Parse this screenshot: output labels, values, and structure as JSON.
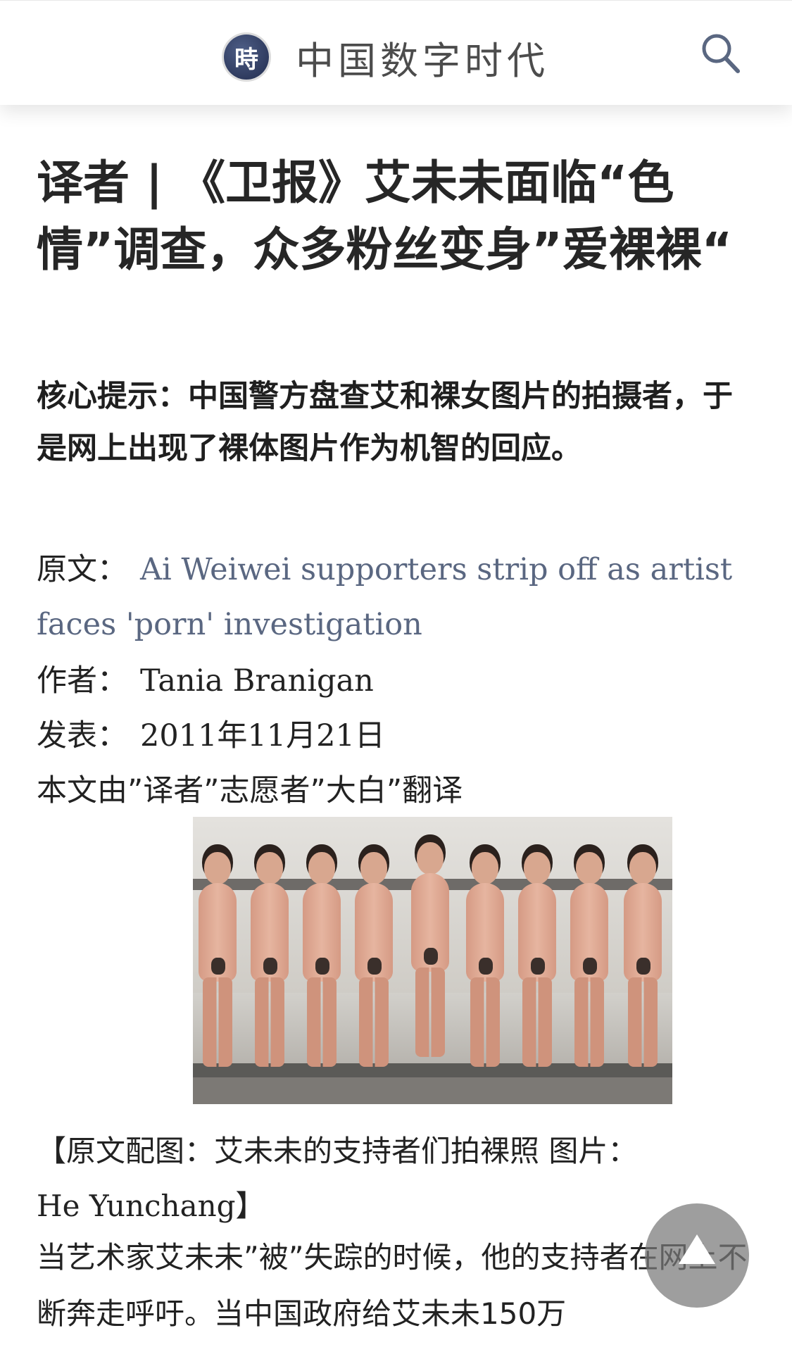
{
  "header": {
    "logo_glyph": "時",
    "site_name": "中国数字时代",
    "search_icon": "search-icon"
  },
  "article": {
    "title": "译者 | 《卫报》艾未未面临“色情”调查，众多粉丝变身”爱裸裸“",
    "summary": "核心提示：中国警方盘查艾和裸女图片的拍摄者，于是网上出现了裸体图片作为机智的回应。",
    "source_label": "原文：",
    "source_link": "Ai Weiwei supporters strip off as artist faces 'porn' investigation",
    "author_label": "作者：",
    "author": "Tania Branigan",
    "date_label": "发表：",
    "date": "2011年11月21日",
    "credit": "本文由”译者”志愿者”大白”翻译",
    "image_caption_cn": "【原文配图：艾未未的支持者们拍裸照 图片：",
    "image_caption_credit": "He Yunchang】",
    "body": "当艺术家艾未未”被”失踪的时候，他的支持者在网上不断奔走呼吁。当中国政府给艾未未150万"
  },
  "ui": {
    "scroll_top_icon": "arrow-up-icon"
  }
}
